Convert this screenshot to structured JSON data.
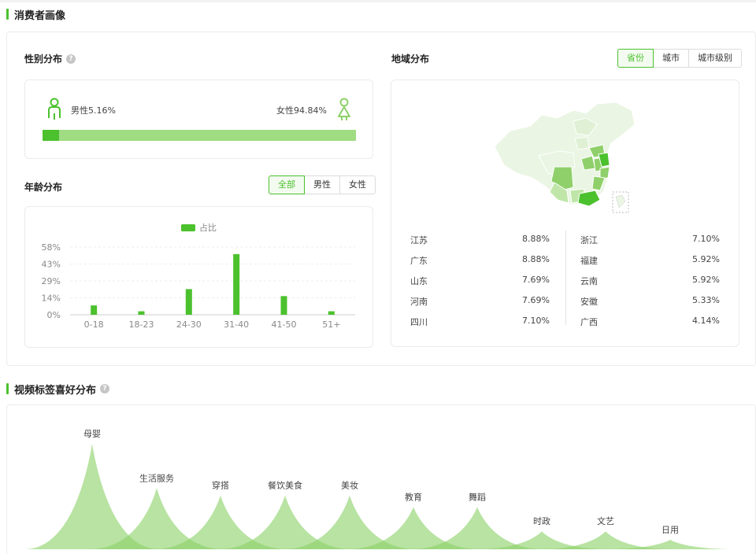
{
  "consumer": {
    "title": "消费者画像",
    "gender": {
      "title": "性别分布",
      "male_label": "男性5.16%",
      "female_label": "女性94.84%",
      "male_share": 5.16,
      "female_share": 94.84
    },
    "age": {
      "title": "年龄分布",
      "tabs": [
        "全部",
        "男性",
        "女性"
      ],
      "active_tab": "全部"
    },
    "region": {
      "title": "地域分布",
      "tabs": [
        "省份",
        "城市",
        "城市级别"
      ],
      "active_tab": "省份",
      "left": [
        {
          "name": "江苏",
          "pct": "8.88%"
        },
        {
          "name": "广东",
          "pct": "8.88%"
        },
        {
          "name": "山东",
          "pct": "7.69%"
        },
        {
          "name": "河南",
          "pct": "7.69%"
        },
        {
          "name": "四川",
          "pct": "7.10%"
        }
      ],
      "right": [
        {
          "name": "浙江",
          "pct": "7.10%"
        },
        {
          "name": "福建",
          "pct": "5.92%"
        },
        {
          "name": "云南",
          "pct": "5.92%"
        },
        {
          "name": "安徽",
          "pct": "5.33%"
        },
        {
          "name": "广西",
          "pct": "4.14%"
        }
      ]
    }
  },
  "tags": {
    "title": "视频标签喜好分布"
  },
  "colors": {
    "accent": "#4cc12e",
    "light_green": "#9fdc82",
    "map_base": "#eaf5e3"
  },
  "chart_data": [
    {
      "type": "bar",
      "legend": [
        "占比"
      ],
      "categories": [
        "0-18",
        "18-23",
        "24-30",
        "31-40",
        "41-50",
        "51+"
      ],
      "series": [
        {
          "name": "占比",
          "values": [
            8,
            3,
            22,
            52,
            16,
            3
          ]
        }
      ],
      "yticks": [
        "58%",
        "43%",
        "29%",
        "14%",
        "0%"
      ],
      "ylim": [
        0,
        58
      ],
      "grid": true
    },
    {
      "type": "area",
      "categories": [
        "母婴",
        "生活服务",
        "穿搭",
        "餐饮美食",
        "美妆",
        "教育",
        "舞蹈",
        "时政",
        "文艺",
        "日用"
      ],
      "values": [
        100,
        58,
        51,
        51,
        51,
        40,
        40,
        17,
        17,
        9
      ],
      "ylim": [
        0,
        100
      ]
    }
  ]
}
